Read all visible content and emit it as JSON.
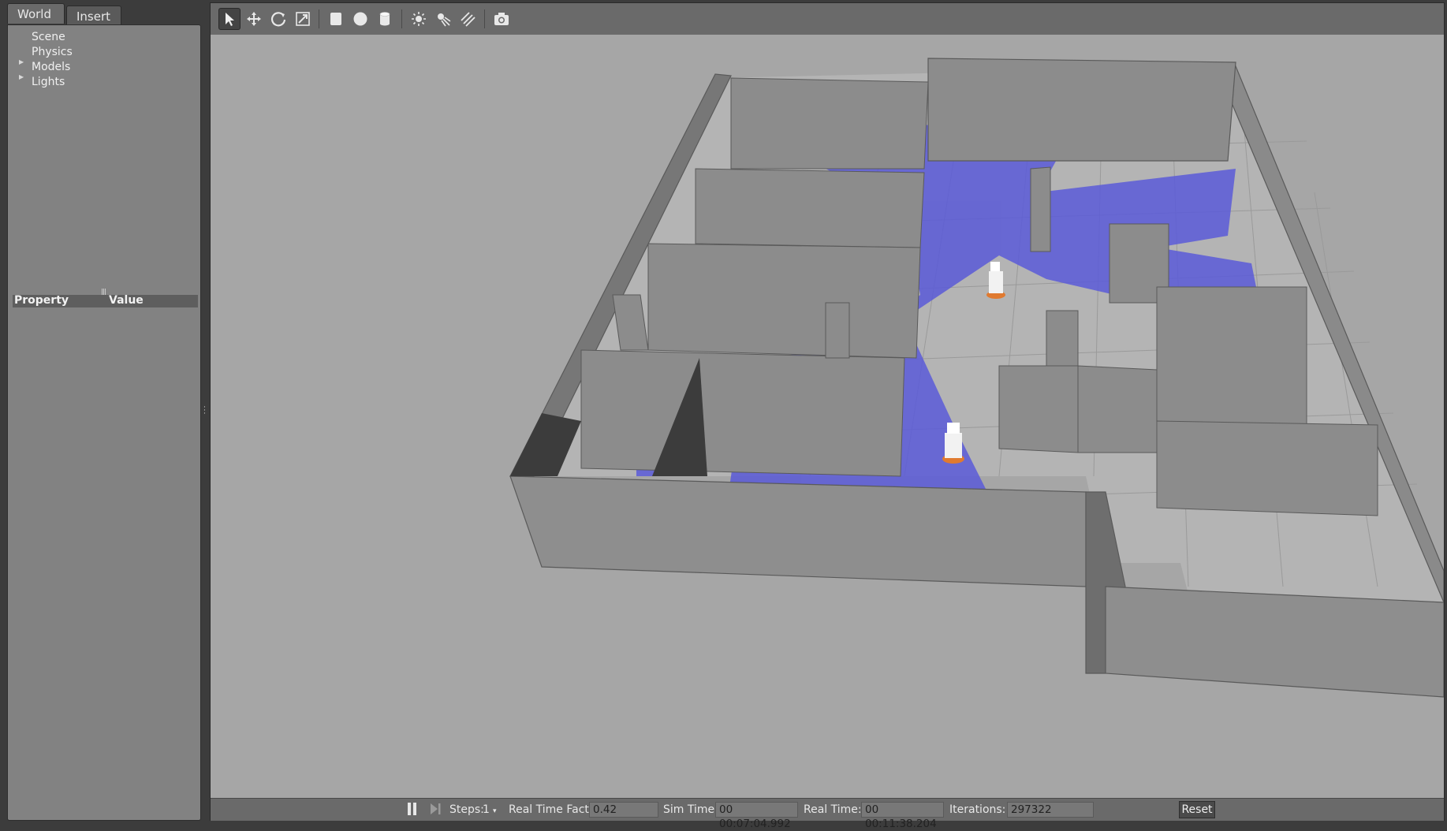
{
  "left_panel": {
    "tabs": [
      {
        "label": "World",
        "active": true
      },
      {
        "label": "Insert",
        "active": false
      }
    ],
    "tree": [
      {
        "label": "Scene",
        "expandable": false
      },
      {
        "label": "Physics",
        "expandable": false
      },
      {
        "label": "Models",
        "expandable": true
      },
      {
        "label": "Lights",
        "expandable": true
      }
    ],
    "properties": {
      "col_property": "Property",
      "col_value": "Value"
    }
  },
  "toolbar": {
    "tools": [
      {
        "icon": "select-arrow-icon",
        "active": true
      },
      {
        "icon": "translate-icon",
        "active": false
      },
      {
        "icon": "rotate-icon",
        "active": false
      },
      {
        "icon": "scale-icon",
        "active": false
      },
      {
        "icon": "box-icon",
        "active": false
      },
      {
        "icon": "sphere-icon",
        "active": false
      },
      {
        "icon": "cylinder-icon",
        "active": false
      },
      {
        "icon": "point-light-icon",
        "active": false
      },
      {
        "icon": "spot-light-icon",
        "active": false
      },
      {
        "icon": "directional-light-icon",
        "active": false
      },
      {
        "icon": "camera-icon",
        "active": false
      }
    ]
  },
  "statusbar": {
    "steps_label": "Steps:",
    "steps_value": "1",
    "rtf_label": "Real Time Factor:",
    "rtf_value": "0.42",
    "sim_time_label": "Sim Time:",
    "sim_time_value": "00 00:07:04.992",
    "real_time_label": "Real Time:",
    "real_time_value": "00 00:11:38.204",
    "iterations_label": "Iterations:",
    "iterations_value": "297322",
    "reset_label": "Reset"
  },
  "colors": {
    "viewport_bg": "#a6a6a6",
    "wall": "#8c8c8c",
    "laser": "#5a5ad8"
  }
}
